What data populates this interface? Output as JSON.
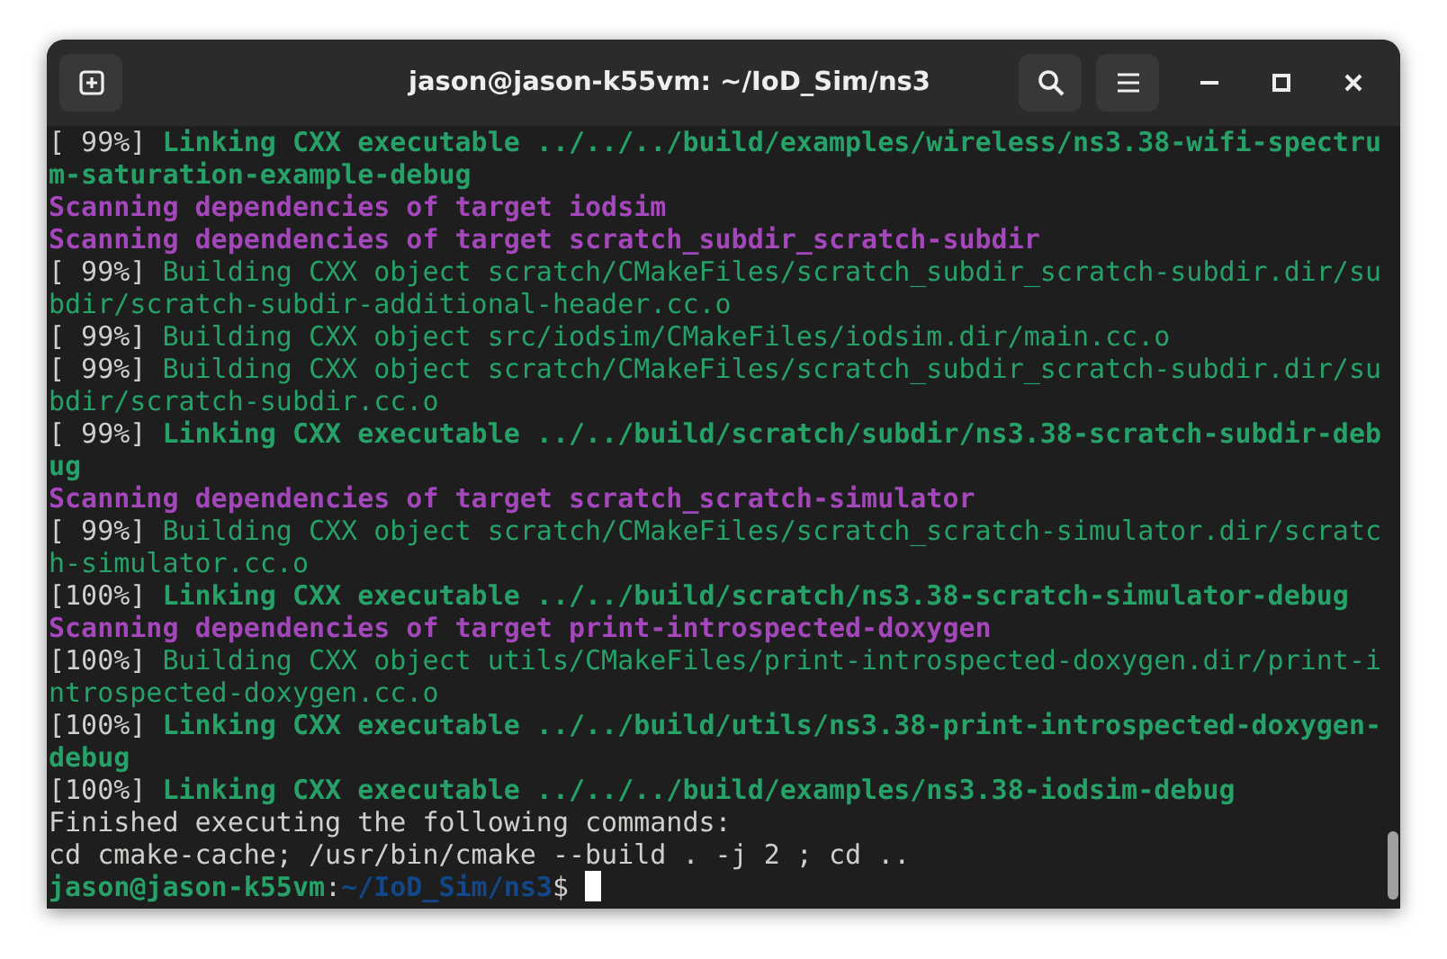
{
  "window": {
    "title": "jason@jason-k55vm: ~/IoD_Sim/ns3"
  },
  "terminal": {
    "lines": [
      {
        "segments": [
          {
            "text": "[ 99%] ",
            "kind": "progress"
          },
          {
            "text": "Linking CXX executable ../../../build/examples/wireless/ns3.38-wifi-spectru",
            "kind": "link"
          }
        ]
      },
      {
        "segments": [
          {
            "text": "m-saturation-example-debug",
            "kind": "link"
          }
        ]
      },
      {
        "segments": [
          {
            "text": "Scanning dependencies of target iodsim",
            "kind": "scan"
          }
        ]
      },
      {
        "segments": [
          {
            "text": "Scanning dependencies of target scratch_subdir_scratch-subdir",
            "kind": "scan"
          }
        ]
      },
      {
        "segments": [
          {
            "text": "[ 99%] ",
            "kind": "progress"
          },
          {
            "text": "Building CXX object scratch/CMakeFiles/scratch_subdir_scratch-subdir.dir/su",
            "kind": "build"
          }
        ]
      },
      {
        "segments": [
          {
            "text": "bdir/scratch-subdir-additional-header.cc.o",
            "kind": "build"
          }
        ]
      },
      {
        "segments": [
          {
            "text": "[ 99%] ",
            "kind": "progress"
          },
          {
            "text": "Building CXX object src/iodsim/CMakeFiles/iodsim.dir/main.cc.o",
            "kind": "build"
          }
        ]
      },
      {
        "segments": [
          {
            "text": "[ 99%] ",
            "kind": "progress"
          },
          {
            "text": "Building CXX object scratch/CMakeFiles/scratch_subdir_scratch-subdir.dir/su",
            "kind": "build"
          }
        ]
      },
      {
        "segments": [
          {
            "text": "bdir/scratch-subdir.cc.o",
            "kind": "build"
          }
        ]
      },
      {
        "segments": [
          {
            "text": "[ 99%] ",
            "kind": "progress"
          },
          {
            "text": "Linking CXX executable ../../build/scratch/subdir/ns3.38-scratch-subdir-deb",
            "kind": "link"
          }
        ]
      },
      {
        "segments": [
          {
            "text": "ug",
            "kind": "link"
          }
        ]
      },
      {
        "segments": [
          {
            "text": "Scanning dependencies of target scratch_scratch-simulator",
            "kind": "scan"
          }
        ]
      },
      {
        "segments": [
          {
            "text": "[ 99%] ",
            "kind": "progress"
          },
          {
            "text": "Building CXX object scratch/CMakeFiles/scratch_scratch-simulator.dir/scratc",
            "kind": "build"
          }
        ]
      },
      {
        "segments": [
          {
            "text": "h-simulator.cc.o",
            "kind": "build"
          }
        ]
      },
      {
        "segments": [
          {
            "text": "[100%] ",
            "kind": "progress"
          },
          {
            "text": "Linking CXX executable ../../build/scratch/ns3.38-scratch-simulator-debug",
            "kind": "link"
          }
        ]
      },
      {
        "segments": [
          {
            "text": "Scanning dependencies of target print-introspected-doxygen",
            "kind": "scan"
          }
        ]
      },
      {
        "segments": [
          {
            "text": "[100%] ",
            "kind": "progress"
          },
          {
            "text": "Building CXX object utils/CMakeFiles/print-introspected-doxygen.dir/print-i",
            "kind": "build"
          }
        ]
      },
      {
        "segments": [
          {
            "text": "ntrospected-doxygen.cc.o",
            "kind": "build"
          }
        ]
      },
      {
        "segments": [
          {
            "text": "[100%] ",
            "kind": "progress"
          },
          {
            "text": "Linking CXX executable ../../build/utils/ns3.38-print-introspected-doxygen-",
            "kind": "link"
          }
        ]
      },
      {
        "segments": [
          {
            "text": "debug",
            "kind": "link"
          }
        ]
      },
      {
        "segments": [
          {
            "text": "[100%] ",
            "kind": "progress"
          },
          {
            "text": "Linking CXX executable ../../../build/examples/ns3.38-iodsim-debug",
            "kind": "link"
          }
        ]
      },
      {
        "segments": [
          {
            "text": "Finished executing the following commands:",
            "kind": "output"
          }
        ]
      },
      {
        "segments": [
          {
            "text": "cd cmake-cache; /usr/bin/cmake --build . -j 2 ; cd ..",
            "kind": "output"
          }
        ]
      },
      {
        "segments": [
          {
            "text": "jason@jason-k55vm",
            "kind": "user"
          },
          {
            "text": ":",
            "kind": "output"
          },
          {
            "text": "~/IoD_Sim/ns3",
            "kind": "path"
          },
          {
            "text": "$ ",
            "kind": "output"
          }
        ],
        "cursor": true
      }
    ]
  }
}
